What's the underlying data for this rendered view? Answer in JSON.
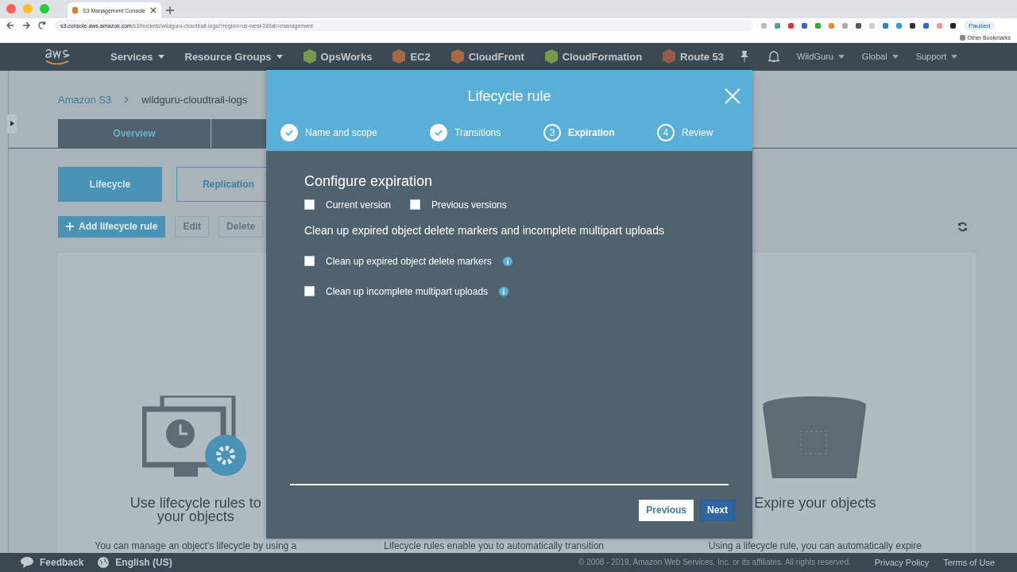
{
  "browser": {
    "tab_title": "S3 Management Console",
    "url_host": "s3.console.aws.amazon.com",
    "url_path": "/s3/buckets/wildguru-cloudtrail-logs/?region=us-west-2&tab=management",
    "profile": "Paused",
    "bookmarks": "Other Bookmarks"
  },
  "nav": {
    "items": [
      {
        "label": "Services",
        "kind": "menu"
      },
      {
        "label": "Resource Groups",
        "kind": "menu"
      },
      {
        "label": "OpsWorks",
        "kind": "service",
        "color": "#7a9a4a"
      },
      {
        "label": "EC2",
        "kind": "service",
        "color": "#a8673f"
      },
      {
        "label": "CloudFront",
        "kind": "service",
        "color": "#a8673f"
      },
      {
        "label": "CloudFormation",
        "kind": "service",
        "color": "#7a9a4a"
      },
      {
        "label": "Route 53",
        "kind": "service",
        "color": "#9a5a4a"
      }
    ],
    "account": [
      {
        "label": "WildGuru"
      },
      {
        "label": "Global"
      },
      {
        "label": "Support"
      }
    ]
  },
  "breadcrumb": [
    {
      "label": "Amazon S3",
      "link": true
    },
    {
      "label": "wildguru-cloudtrail-logs",
      "link": false
    }
  ],
  "tabs": [
    {
      "label": "Overview",
      "selected": false
    }
  ],
  "subtabs": [
    {
      "label": "Lifecycle",
      "selected": true
    },
    {
      "label": "Replication",
      "selected": false
    }
  ],
  "actions": [
    {
      "label": "Add lifecycle rule",
      "disabled": false
    },
    {
      "label": "Edit",
      "disabled": true
    },
    {
      "label": "Delete",
      "disabled": true
    }
  ],
  "intro": [
    {
      "kind": "lifecycle",
      "heading": [
        "Use lifecycle rules to",
        "your objects"
      ],
      "text": "You can manage an object's lifecycle by using a"
    },
    {
      "kind": "transition",
      "text": "Lifecycle rules enable you to automatically transition"
    },
    {
      "kind": "expire",
      "heading": [
        "Expire your objects"
      ],
      "text": "Using a lifecycle rule, you can automatically expire"
    }
  ],
  "modal": {
    "title": "Lifecycle rule",
    "steps": [
      {
        "label": "Name and scope",
        "completed": true,
        "selected": false
      },
      {
        "label": "Transitions",
        "completed": true,
        "selected": false
      },
      {
        "label": "Expiration",
        "number": "3",
        "completed": false,
        "selected": true
      },
      {
        "label": "Review",
        "number": "4",
        "completed": false,
        "selected": false
      }
    ],
    "heading": "Configure expiration",
    "versions": [
      {
        "label": "Current version",
        "checked": false
      },
      {
        "label": "Previous versions",
        "checked": false
      }
    ],
    "cleanup_heading": "Clean up expired object delete markers and incomplete multipart uploads",
    "cleanup": [
      {
        "label": "Clean up expired object delete markers",
        "checked": false
      },
      {
        "label": "Clean up incomplete multipart uploads",
        "checked": false
      }
    ],
    "buttons": [
      {
        "label": "Previous",
        "kind": "secondary"
      },
      {
        "label": "Next",
        "kind": "primary"
      }
    ]
  },
  "footer": {
    "feedback": "Feedback",
    "language": "English (US)",
    "copyright": "© 2008 - 2019, Amazon Web Services, Inc. or its affiliates. All rights reserved.",
    "links": [
      "Privacy Policy",
      "Terms of Use"
    ]
  }
}
